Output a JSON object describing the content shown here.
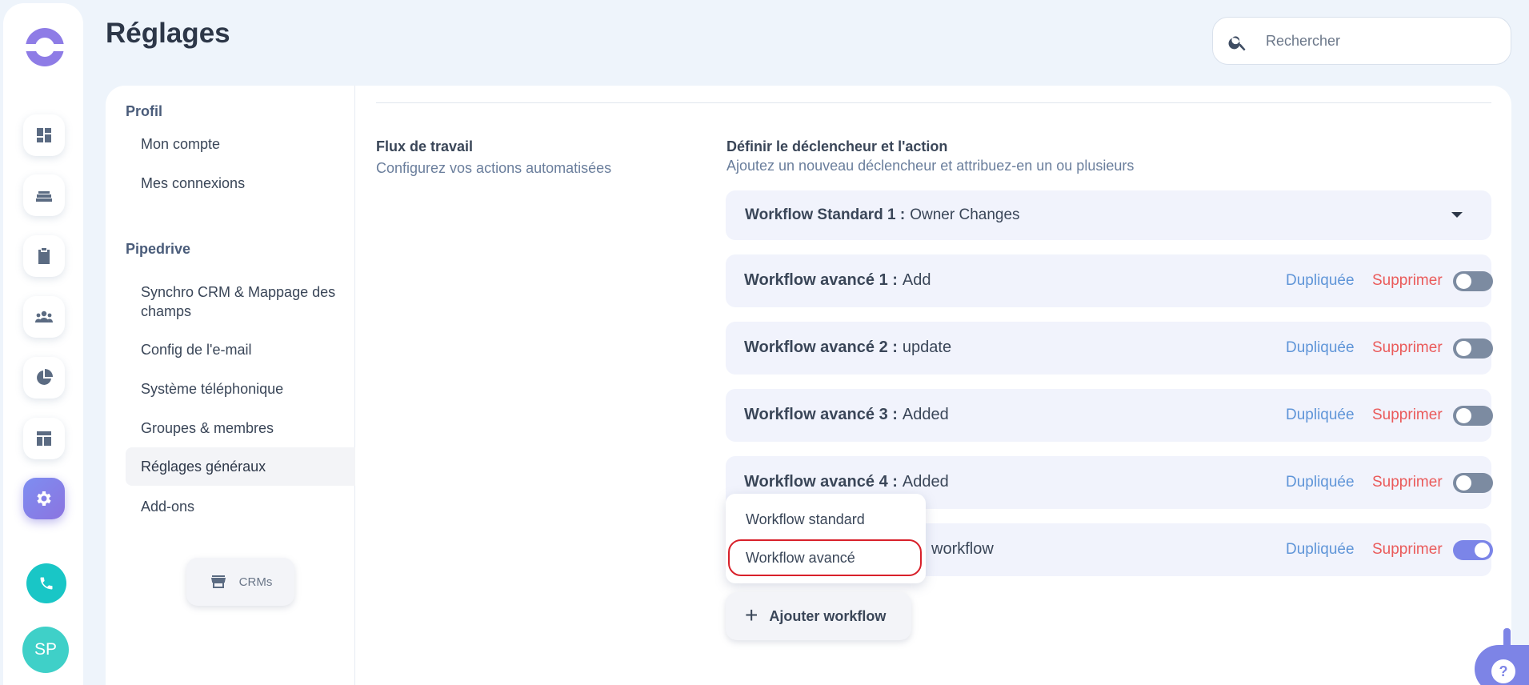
{
  "page": {
    "title": "Réglages"
  },
  "search": {
    "placeholder": "Rechercher"
  },
  "rail": {
    "items": [
      {
        "icon": "dashboard-icon"
      },
      {
        "icon": "stack-icon"
      },
      {
        "icon": "clipboard-icon"
      },
      {
        "icon": "users-icon"
      },
      {
        "icon": "pie-chart-icon"
      },
      {
        "icon": "layout-icon"
      },
      {
        "icon": "gear-icon",
        "active": true
      }
    ],
    "avatar": "SP"
  },
  "settings_nav": {
    "profile_section": "Profil",
    "profile_items": [
      "Mon compte",
      "Mes connexions"
    ],
    "pipedrive_section": "Pipedrive",
    "pipedrive_items": [
      "Synchro CRM & Mappage des champs",
      "Config de l'e-mail",
      "Système téléphonique",
      "Groupes & membres",
      "Réglages généraux",
      "Add-ons"
    ],
    "active_item": "Réglages généraux",
    "crms_button": "CRMs"
  },
  "workflow": {
    "section_title": "Flux de travail",
    "section_subtitle": "Configurez vos actions automatisées",
    "define_title": "Définir le déclencheur et l'action",
    "define_subtitle": "Ajoutez un nouveau déclencheur et attribuez-en un ou plusieurs",
    "standard": {
      "name": "Workflow Standard 1 :",
      "value": "Owner Changes"
    },
    "rows": [
      {
        "name": "Workflow avancé 1 :",
        "value": "Add",
        "duplicate": "Dupliquée",
        "delete": "Supprimer",
        "enabled": false
      },
      {
        "name": "Workflow avancé 2 :",
        "value": "update",
        "duplicate": "Dupliquée",
        "delete": "Supprimer",
        "enabled": false
      },
      {
        "name": "Workflow avancé 3 :",
        "value": "Added",
        "duplicate": "Dupliquée",
        "delete": "Supprimer",
        "enabled": false
      },
      {
        "name": "Workflow avancé 4 :",
        "value": "Added",
        "duplicate": "Dupliquée",
        "delete": "Supprimer",
        "enabled": false
      },
      {
        "name": "",
        "value": "workflow",
        "duplicate": "Dupliquée",
        "delete": "Supprimer",
        "enabled": true
      }
    ],
    "dropdown_options": [
      "Workflow standard",
      "Workflow avancé"
    ],
    "add_button": "Ajouter workflow"
  },
  "help": {
    "label": "?"
  },
  "colors": {
    "accent": "#7b85e8",
    "duplicate": "#5f95d8",
    "delete": "#ea5a5a",
    "highlight_border": "#d8202a"
  }
}
